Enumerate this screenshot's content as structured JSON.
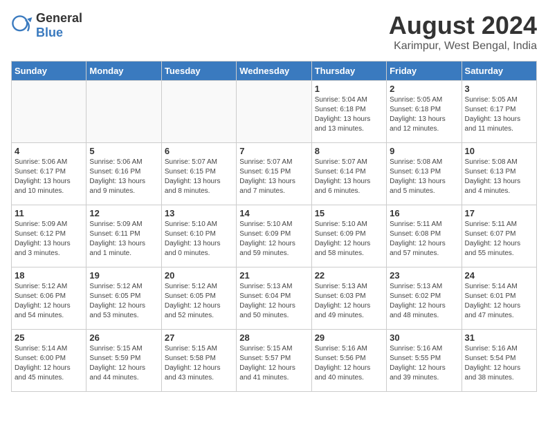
{
  "header": {
    "logo_general": "General",
    "logo_blue": "Blue",
    "month_title": "August 2024",
    "location": "Karimpur, West Bengal, India"
  },
  "days_of_week": [
    "Sunday",
    "Monday",
    "Tuesday",
    "Wednesday",
    "Thursday",
    "Friday",
    "Saturday"
  ],
  "weeks": [
    [
      {
        "day": "",
        "info": ""
      },
      {
        "day": "",
        "info": ""
      },
      {
        "day": "",
        "info": ""
      },
      {
        "day": "",
        "info": ""
      },
      {
        "day": "1",
        "info": "Sunrise: 5:04 AM\nSunset: 6:18 PM\nDaylight: 13 hours\nand 13 minutes."
      },
      {
        "day": "2",
        "info": "Sunrise: 5:05 AM\nSunset: 6:18 PM\nDaylight: 13 hours\nand 12 minutes."
      },
      {
        "day": "3",
        "info": "Sunrise: 5:05 AM\nSunset: 6:17 PM\nDaylight: 13 hours\nand 11 minutes."
      }
    ],
    [
      {
        "day": "4",
        "info": "Sunrise: 5:06 AM\nSunset: 6:17 PM\nDaylight: 13 hours\nand 10 minutes."
      },
      {
        "day": "5",
        "info": "Sunrise: 5:06 AM\nSunset: 6:16 PM\nDaylight: 13 hours\nand 9 minutes."
      },
      {
        "day": "6",
        "info": "Sunrise: 5:07 AM\nSunset: 6:15 PM\nDaylight: 13 hours\nand 8 minutes."
      },
      {
        "day": "7",
        "info": "Sunrise: 5:07 AM\nSunset: 6:15 PM\nDaylight: 13 hours\nand 7 minutes."
      },
      {
        "day": "8",
        "info": "Sunrise: 5:07 AM\nSunset: 6:14 PM\nDaylight: 13 hours\nand 6 minutes."
      },
      {
        "day": "9",
        "info": "Sunrise: 5:08 AM\nSunset: 6:13 PM\nDaylight: 13 hours\nand 5 minutes."
      },
      {
        "day": "10",
        "info": "Sunrise: 5:08 AM\nSunset: 6:13 PM\nDaylight: 13 hours\nand 4 minutes."
      }
    ],
    [
      {
        "day": "11",
        "info": "Sunrise: 5:09 AM\nSunset: 6:12 PM\nDaylight: 13 hours\nand 3 minutes."
      },
      {
        "day": "12",
        "info": "Sunrise: 5:09 AM\nSunset: 6:11 PM\nDaylight: 13 hours\nand 1 minute."
      },
      {
        "day": "13",
        "info": "Sunrise: 5:10 AM\nSunset: 6:10 PM\nDaylight: 13 hours\nand 0 minutes."
      },
      {
        "day": "14",
        "info": "Sunrise: 5:10 AM\nSunset: 6:09 PM\nDaylight: 12 hours\nand 59 minutes."
      },
      {
        "day": "15",
        "info": "Sunrise: 5:10 AM\nSunset: 6:09 PM\nDaylight: 12 hours\nand 58 minutes."
      },
      {
        "day": "16",
        "info": "Sunrise: 5:11 AM\nSunset: 6:08 PM\nDaylight: 12 hours\nand 57 minutes."
      },
      {
        "day": "17",
        "info": "Sunrise: 5:11 AM\nSunset: 6:07 PM\nDaylight: 12 hours\nand 55 minutes."
      }
    ],
    [
      {
        "day": "18",
        "info": "Sunrise: 5:12 AM\nSunset: 6:06 PM\nDaylight: 12 hours\nand 54 minutes."
      },
      {
        "day": "19",
        "info": "Sunrise: 5:12 AM\nSunset: 6:05 PM\nDaylight: 12 hours\nand 53 minutes."
      },
      {
        "day": "20",
        "info": "Sunrise: 5:12 AM\nSunset: 6:05 PM\nDaylight: 12 hours\nand 52 minutes."
      },
      {
        "day": "21",
        "info": "Sunrise: 5:13 AM\nSunset: 6:04 PM\nDaylight: 12 hours\nand 50 minutes."
      },
      {
        "day": "22",
        "info": "Sunrise: 5:13 AM\nSunset: 6:03 PM\nDaylight: 12 hours\nand 49 minutes."
      },
      {
        "day": "23",
        "info": "Sunrise: 5:13 AM\nSunset: 6:02 PM\nDaylight: 12 hours\nand 48 minutes."
      },
      {
        "day": "24",
        "info": "Sunrise: 5:14 AM\nSunset: 6:01 PM\nDaylight: 12 hours\nand 47 minutes."
      }
    ],
    [
      {
        "day": "25",
        "info": "Sunrise: 5:14 AM\nSunset: 6:00 PM\nDaylight: 12 hours\nand 45 minutes."
      },
      {
        "day": "26",
        "info": "Sunrise: 5:15 AM\nSunset: 5:59 PM\nDaylight: 12 hours\nand 44 minutes."
      },
      {
        "day": "27",
        "info": "Sunrise: 5:15 AM\nSunset: 5:58 PM\nDaylight: 12 hours\nand 43 minutes."
      },
      {
        "day": "28",
        "info": "Sunrise: 5:15 AM\nSunset: 5:57 PM\nDaylight: 12 hours\nand 41 minutes."
      },
      {
        "day": "29",
        "info": "Sunrise: 5:16 AM\nSunset: 5:56 PM\nDaylight: 12 hours\nand 40 minutes."
      },
      {
        "day": "30",
        "info": "Sunrise: 5:16 AM\nSunset: 5:55 PM\nDaylight: 12 hours\nand 39 minutes."
      },
      {
        "day": "31",
        "info": "Sunrise: 5:16 AM\nSunset: 5:54 PM\nDaylight: 12 hours\nand 38 minutes."
      }
    ]
  ]
}
